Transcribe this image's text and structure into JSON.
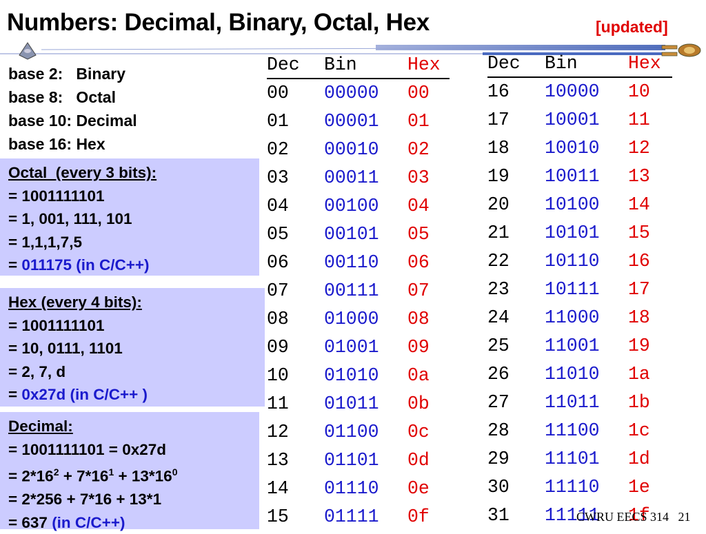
{
  "title": "Numbers: Decimal, Binary, Octal, Hex",
  "updated_label": "[updated]",
  "bases": [
    "base 2:   Binary",
    "base 8:   Octal",
    "base 10: Decimal",
    "base 16: Hex"
  ],
  "octal_box": {
    "heading": "Octal  (every 3 bits):",
    "lines": [
      "= 1001111101",
      "= 1, 001, 111, 101",
      "= 1,1,1,7,5"
    ],
    "result_prefix": "= ",
    "result": "011175 (in C/C++)"
  },
  "hex_box": {
    "heading": "Hex (every 4 bits):",
    "lines": [
      "= 1001111101",
      "= 10, 0111, 1101",
      "= 2, 7, d"
    ],
    "result_prefix": "= ",
    "result": "0x27d (in C/C++ )"
  },
  "decimal_box": {
    "heading": "Decimal:",
    "line1": "= 1001111101 = 0x27d",
    "line2_parts": [
      "= 2*16",
      "2",
      " + 7*16",
      "1",
      " + 13*16",
      "0"
    ],
    "line3": "= 2*256 + 7*16 + 13*1",
    "result_prefix": "= 637 ",
    "result": "(in C/C++)"
  },
  "table_headers": {
    "dec": "Dec",
    "bin": "Bin",
    "hex": "Hex"
  },
  "table_left": [
    [
      "00",
      "00000",
      "00"
    ],
    [
      "01",
      "00001",
      "01"
    ],
    [
      "02",
      "00010",
      "02"
    ],
    [
      "03",
      "00011",
      "03"
    ],
    [
      "04",
      "00100",
      "04"
    ],
    [
      "05",
      "00101",
      "05"
    ],
    [
      "06",
      "00110",
      "06"
    ],
    [
      "07",
      "00111",
      "07"
    ],
    [
      "08",
      "01000",
      "08"
    ],
    [
      "09",
      "01001",
      "09"
    ],
    [
      "10",
      "01010",
      "0a"
    ],
    [
      "11",
      "01011",
      "0b"
    ],
    [
      "12",
      "01100",
      "0c"
    ],
    [
      "13",
      "01101",
      "0d"
    ],
    [
      "14",
      "01110",
      "0e"
    ],
    [
      "15",
      "01111",
      "0f"
    ]
  ],
  "table_right": [
    [
      "16",
      "10000",
      "10"
    ],
    [
      "17",
      "10001",
      "11"
    ],
    [
      "18",
      "10010",
      "12"
    ],
    [
      "19",
      "10011",
      "13"
    ],
    [
      "20",
      "10100",
      "14"
    ],
    [
      "21",
      "10101",
      "15"
    ],
    [
      "22",
      "10110",
      "16"
    ],
    [
      "23",
      "10111",
      "17"
    ],
    [
      "24",
      "11000",
      "18"
    ],
    [
      "25",
      "11001",
      "19"
    ],
    [
      "26",
      "11010",
      "1a"
    ],
    [
      "27",
      "11011",
      "1b"
    ],
    [
      "28",
      "11100",
      "1c"
    ],
    [
      "29",
      "11101",
      "1d"
    ],
    [
      "30",
      "11110",
      "1e"
    ],
    [
      "31",
      "11111",
      "1f"
    ]
  ],
  "footer": "CWRU EECS 314   21",
  "colors": {
    "binary": "#1a1acc",
    "hex": "#e00000",
    "box_bg": "#ccccff"
  }
}
